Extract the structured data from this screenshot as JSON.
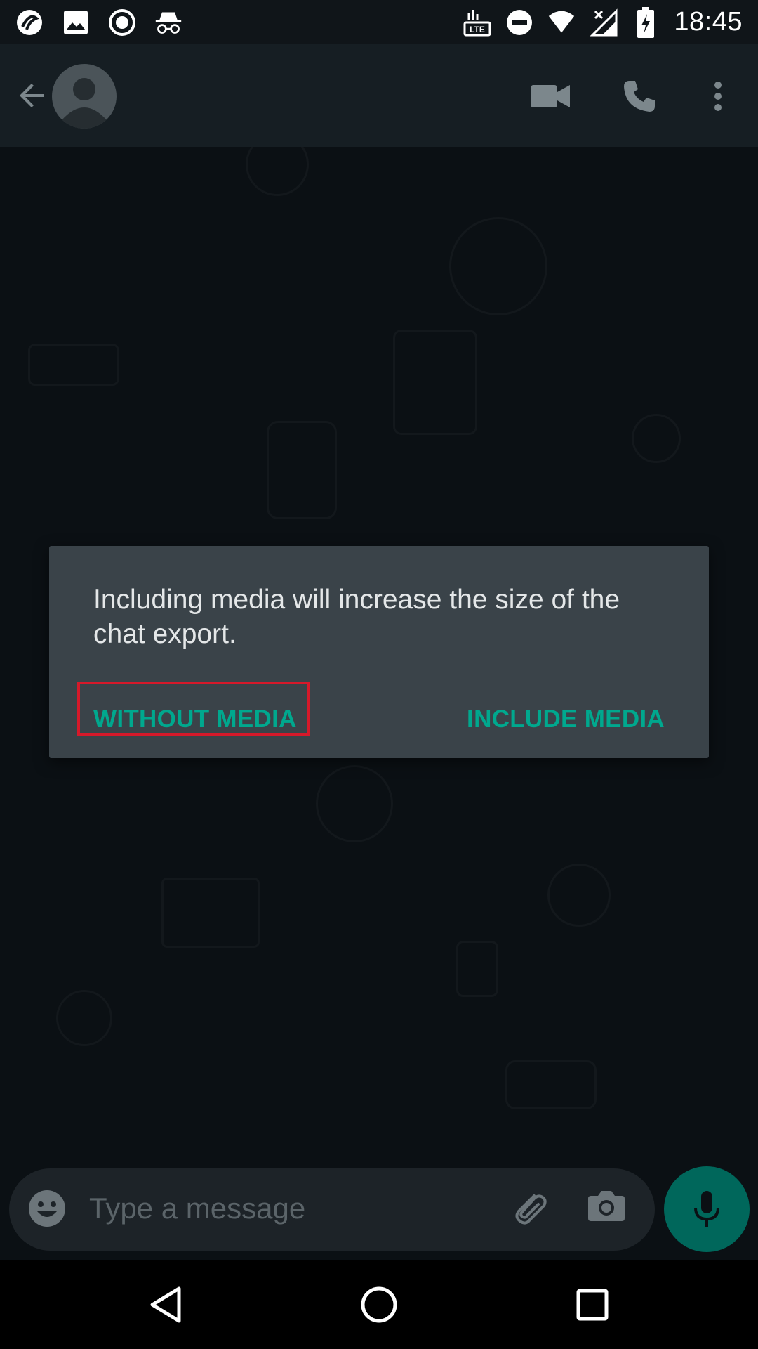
{
  "status_bar": {
    "time": "18:45",
    "network_label": "LTE",
    "left_icons": [
      "app-logo-icon",
      "image-icon",
      "record-icon",
      "incognito-icon"
    ],
    "right_icons": [
      "volte-lte-icon",
      "do-not-disturb-icon",
      "wifi-icon",
      "signal-off-icon",
      "battery-charging-icon"
    ]
  },
  "app_bar": {
    "back_icon": "arrow-back-icon",
    "avatar_icon": "default-avatar-icon",
    "actions": [
      "video-call-icon",
      "voice-call-icon",
      "more-options-icon"
    ]
  },
  "dialog": {
    "message": "Including media will increase the size of the chat export.",
    "without_media_label": "WITHOUT MEDIA",
    "include_media_label": "INCLUDE MEDIA",
    "accent_color": "#00a88e",
    "highlight_color": "#d6192a"
  },
  "input_bar": {
    "placeholder": "Type a message",
    "icons": [
      "emoji-icon",
      "attachment-icon",
      "camera-icon"
    ],
    "send_icon": "mic-icon",
    "mic_color": "#00675b"
  },
  "nav_bar": {
    "icons": [
      "nav-back-icon",
      "nav-home-icon",
      "nav-recents-icon"
    ]
  }
}
